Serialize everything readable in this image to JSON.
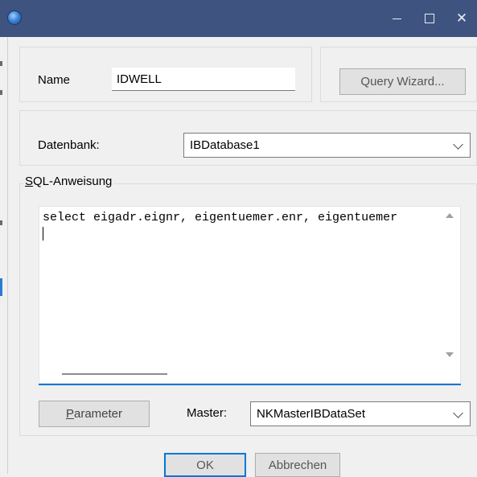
{
  "window": {
    "icon": "app-globe-icon",
    "controls": {
      "minimize": "–",
      "maximize": "□",
      "close": "✕"
    }
  },
  "name_section": {
    "label": "Name",
    "value": "IDWELL",
    "query_wizard_button": "Query Wizard..."
  },
  "database_section": {
    "label": "Datenbank:",
    "selected": "IBDatabase1"
  },
  "sql_section": {
    "legend_mnemonic": "S",
    "legend_rest": "QL-Anweisung",
    "statement": "select eigadr.eignr, eigentuemer.enr, eigentuemer"
  },
  "bottom_controls": {
    "parameter_mnemonic": "P",
    "parameter_rest": "arameter",
    "master_label": "Master:",
    "master_selected": "NKMasterIBDataSet"
  },
  "dialog_buttons": {
    "ok": "OK",
    "cancel": "Abbrechen"
  },
  "colors": {
    "titlebar": "#3f5380",
    "accent": "#1978d4"
  }
}
